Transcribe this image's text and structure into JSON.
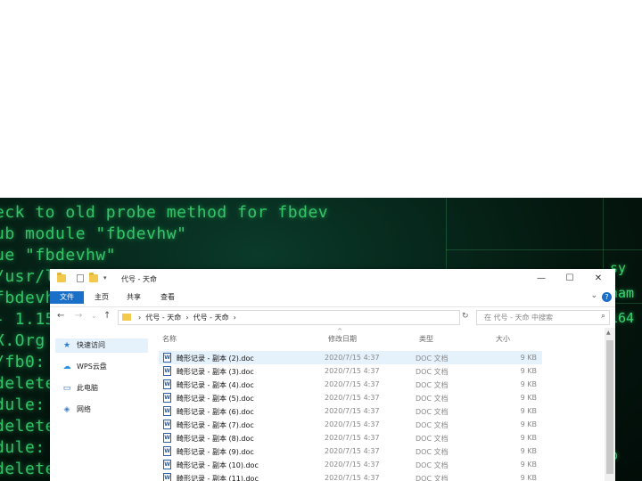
{
  "terminal": {
    "lines": [
      "eck to old probe method for fbdev",
      "ub module \"fbdevhw\"",
      "ue \"fbdevhw\"",
      "/usr/li",
      "fbdevhw",
      "- 1.15",
      "X.Org",
      "/fb0:",
      "delete",
      "dule: \"",
      "delete",
      "dule: \"",
      "deleted"
    ],
    "right_lines": [
      "sy",
      "nam",
      "164",
      "b"
    ]
  },
  "explorer": {
    "title": "代号 - 天命",
    "window_buttons": {
      "minimize": "—",
      "maximize": "☐",
      "close": "✕"
    },
    "ribbon_tabs": [
      "文件",
      "主页",
      "共享",
      "查看"
    ],
    "help": "?",
    "expand": "⌄",
    "nav_buttons": {
      "back": "←",
      "forward": "→",
      "recent": "⌄",
      "up": "↑",
      "refresh": "↻"
    },
    "address": "›  代号 - 天命  ›  代号 - 天命  ›",
    "search_placeholder": "在 代号 - 天命 中搜索",
    "sidebar": [
      {
        "label": "快速访问",
        "icon": "★"
      },
      {
        "label": "WPS云盘",
        "icon": "☁"
      },
      {
        "label": "此电脑",
        "icon": "▭"
      },
      {
        "label": "网络",
        "icon": "◈"
      }
    ],
    "columns": {
      "name": "名称",
      "date": "修改日期",
      "type": "类型",
      "size": "大小"
    },
    "files": [
      {
        "name": "畸形记录 - 副本 (2).doc",
        "date": "2020/7/15 4:37",
        "type": "DOC 文档",
        "size": "9 KB"
      },
      {
        "name": "畸形记录 - 副本 (3).doc",
        "date": "2020/7/15 4:37",
        "type": "DOC 文档",
        "size": "9 KB"
      },
      {
        "name": "畸形记录 - 副本 (4).doc",
        "date": "2020/7/15 4:37",
        "type": "DOC 文档",
        "size": "9 KB"
      },
      {
        "name": "畸形记录 - 副本 (5).doc",
        "date": "2020/7/15 4:37",
        "type": "DOC 文档",
        "size": "9 KB"
      },
      {
        "name": "畸形记录 - 副本 (6).doc",
        "date": "2020/7/15 4:37",
        "type": "DOC 文档",
        "size": "9 KB"
      },
      {
        "name": "畸形记录 - 副本 (7).doc",
        "date": "2020/7/15 4:37",
        "type": "DOC 文档",
        "size": "9 KB"
      },
      {
        "name": "畸形记录 - 副本 (8).doc",
        "date": "2020/7/15 4:37",
        "type": "DOC 文档",
        "size": "9 KB"
      },
      {
        "name": "畸形记录 - 副本 (9).doc",
        "date": "2020/7/15 4:37",
        "type": "DOC 文档",
        "size": "9 KB"
      },
      {
        "name": "畸形记录 - 副本 (10).doc",
        "date": "2020/7/15 4:37",
        "type": "DOC 文档",
        "size": "9 KB"
      },
      {
        "name": "畸形记录 - 副本 (11).doc",
        "date": "2020/7/15 4:37",
        "type": "DOC 文档",
        "size": "9 KB"
      }
    ],
    "colors": {
      "accent": "#1a6fc9",
      "selection": "#e5f1fb",
      "folder": "#f2c94c",
      "terminal_text": "#38d670"
    }
  }
}
